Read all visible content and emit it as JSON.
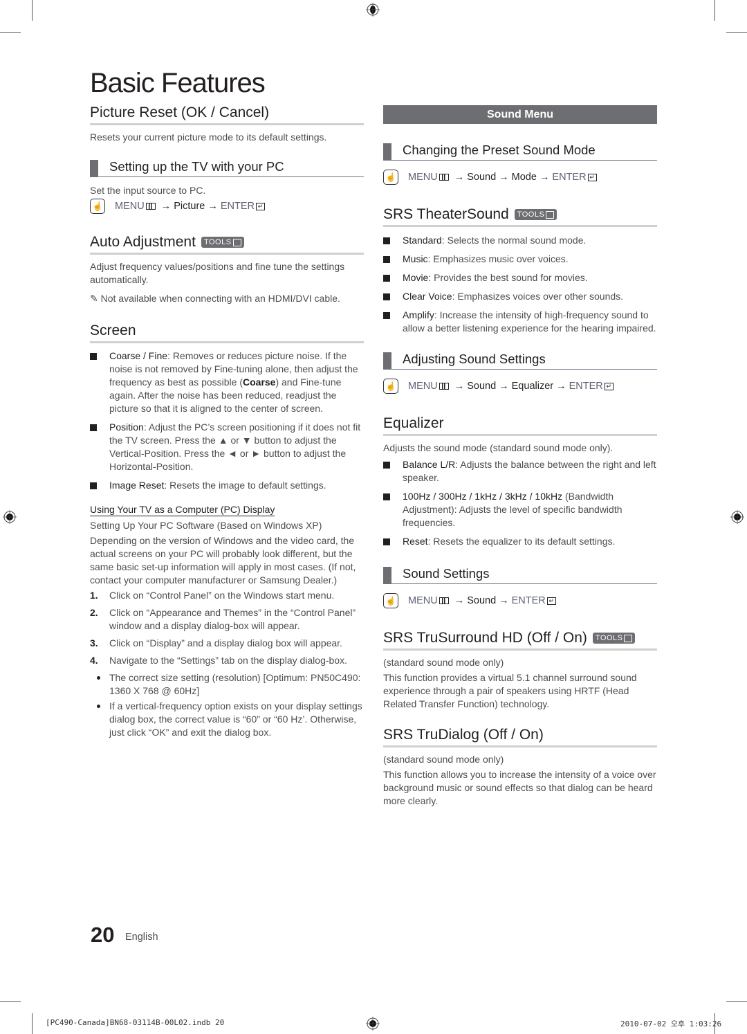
{
  "page": {
    "title": "Basic Features",
    "page_number": "20",
    "language": "English"
  },
  "slug": {
    "file": "[PC490-Canada]BN68-03114B-00L02.indb   20",
    "timestamp": "2010-07-02   오후 1:03:26"
  },
  "common": {
    "tools_label": "TOOLS",
    "menu_label": "MENU",
    "enter_label": "ENTER",
    "arrow": "→",
    "hand_icon": "☝"
  },
  "left": {
    "picture_reset": {
      "heading": "Picture Reset (OK / Cancel)",
      "text": "Resets your current picture mode to its default settings."
    },
    "setting_up_pc": {
      "heading": "Setting up the TV with your PC",
      "text": "Set the input source to PC.",
      "menu_path": [
        "Picture"
      ]
    },
    "auto_adjustment": {
      "heading": "Auto Adjustment",
      "text": "Adjust frequency values/positions and fine tune the settings automatically.",
      "note_icon": "✎",
      "note": "Not available when connecting with an HDMI/DVI cable."
    },
    "screen": {
      "heading": "Screen",
      "items": [
        {
          "term": "Coarse / Fine",
          "text_a": ": Removes or reduces picture noise. If the noise is not removed by Fine-tuning alone, then adjust the frequency as best as possible (",
          "term2": "Coarse",
          "text_b": ") and Fine-tune again. After the noise has been reduced, readjust the picture so that it is aligned to the center of screen."
        },
        {
          "term": "Position",
          "text_a": ": Adjust the PC’s screen positioning if it does not fit the TV screen. Press the ▲ or ▼ button to adjust the Vertical-Position. Press the ◄ or ► button to adjust the Horizontal-Position.",
          "term2": "",
          "text_b": ""
        },
        {
          "term": "Image Reset",
          "text_a": ": Resets the image to default settings.",
          "term2": "",
          "text_b": ""
        }
      ]
    },
    "pc_display": {
      "heading": "Using Your TV as a Computer (PC) Display",
      "subheading": "Setting Up Your PC Software (Based on Windows XP)",
      "intro": "Depending on the version of Windows and the video card, the actual screens on your PC will probably look different, but the same basic set-up information will apply in most cases. (If not, contact your computer manufacturer or Samsung Dealer.)",
      "steps": [
        {
          "n": "1.",
          "text": "Click on “Control Panel” on the Windows start menu."
        },
        {
          "n": "2.",
          "text": "Click on “Appearance and Themes” in the “Control Panel” window and a display dialog-box will appear."
        },
        {
          "n": "3.",
          "text": "Click on “Display” and a display dialog box will appear."
        },
        {
          "n": "4.",
          "text": "Navigate to the “Settings” tab on the display dialog-box."
        }
      ],
      "notes": [
        "The correct size setting (resolution) [Optimum: PN50C490: 1360 X 768 @ 60Hz]",
        "If a vertical-frequency option exists on your display settings dialog box, the correct value is “60” or “60 Hz’. Otherwise, just click “OK” and exit the dialog box."
      ]
    }
  },
  "right": {
    "section_bar": "Sound Menu",
    "preset_mode": {
      "heading": "Changing the Preset Sound Mode",
      "menu_path": [
        "Sound",
        "Mode"
      ]
    },
    "theater_sound": {
      "heading": "SRS TheaterSound",
      "items": [
        {
          "term": "Standard",
          "text": ": Selects the normal sound mode."
        },
        {
          "term": "Music",
          "text": ": Emphasizes music over voices."
        },
        {
          "term": "Movie",
          "text": ": Provides the best sound for movies."
        },
        {
          "term": "Clear Voice",
          "text": ": Emphasizes voices over other sounds."
        },
        {
          "term": "Amplify",
          "text": ": Increase the intensity of high-frequency sound to allow a better listening experience for the hearing impaired."
        }
      ]
    },
    "adjusting": {
      "heading": "Adjusting Sound Settings",
      "menu_path": [
        "Sound",
        "Equalizer"
      ]
    },
    "equalizer": {
      "heading": "Equalizer",
      "text": "Adjusts the sound mode (standard sound mode only).",
      "items": [
        {
          "term": "Balance L/R",
          "text": ": Adjusts the balance between the right and left speaker."
        },
        {
          "term": "100Hz / 300Hz / 1kHz / 3kHz / 10kHz",
          "text": " (Bandwidth Adjustment): Adjusts the level of specific bandwidth frequencies."
        },
        {
          "term": "Reset",
          "text": ": Resets the equalizer to its default settings."
        }
      ]
    },
    "sound_settings": {
      "heading": "Sound Settings",
      "menu_path": [
        "Sound"
      ]
    },
    "trusurround": {
      "heading": "SRS TruSurround HD (Off / On)",
      "note": "(standard sound mode only)",
      "text": "This function provides a virtual 5.1 channel surround sound experience through a pair of speakers using HRTF (Head Related Transfer Function) technology."
    },
    "trudialog": {
      "heading": "SRS TruDialog (Off / On)",
      "note": "(standard sound mode only)",
      "text": "This function allows you to increase the intensity of a voice over background music or sound effects so that dialog can be heard more clearly."
    }
  }
}
